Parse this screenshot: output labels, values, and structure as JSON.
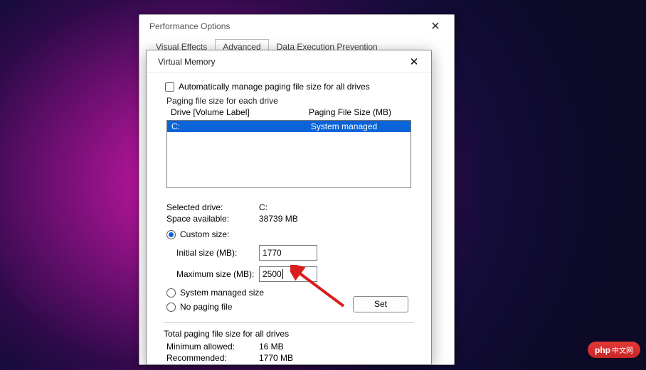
{
  "perf": {
    "title": "Performance Options",
    "tabs": {
      "visual": "Visual Effects",
      "advanced": "Advanced",
      "dep": "Data Execution Prevention"
    }
  },
  "vm": {
    "title": "Virtual Memory",
    "auto_manage": "Automatically manage paging file size for all drives",
    "group_label": "Paging file size for each drive",
    "col_drive": "Drive  [Volume Label]",
    "col_size": "Paging File Size (MB)",
    "drive_letter": "C:",
    "drive_mode": "System managed",
    "selected_drive_label": "Selected drive:",
    "selected_drive_value": "C:",
    "space_label": "Space available:",
    "space_value": "38739 MB",
    "custom_size": "Custom size:",
    "initial_label": "Initial size (MB):",
    "initial_value": "1770",
    "max_label": "Maximum size (MB):",
    "max_value": "2500",
    "system_managed": "System managed size",
    "no_paging": "No paging file",
    "set_btn": "Set",
    "totals_label": "Total paging file size for all drives",
    "min_label": "Minimum allowed:",
    "min_value": "16 MB",
    "rec_label": "Recommended:",
    "rec_value": "1770 MB"
  },
  "watermark": {
    "brand": "php",
    "suffix": "中文网"
  }
}
